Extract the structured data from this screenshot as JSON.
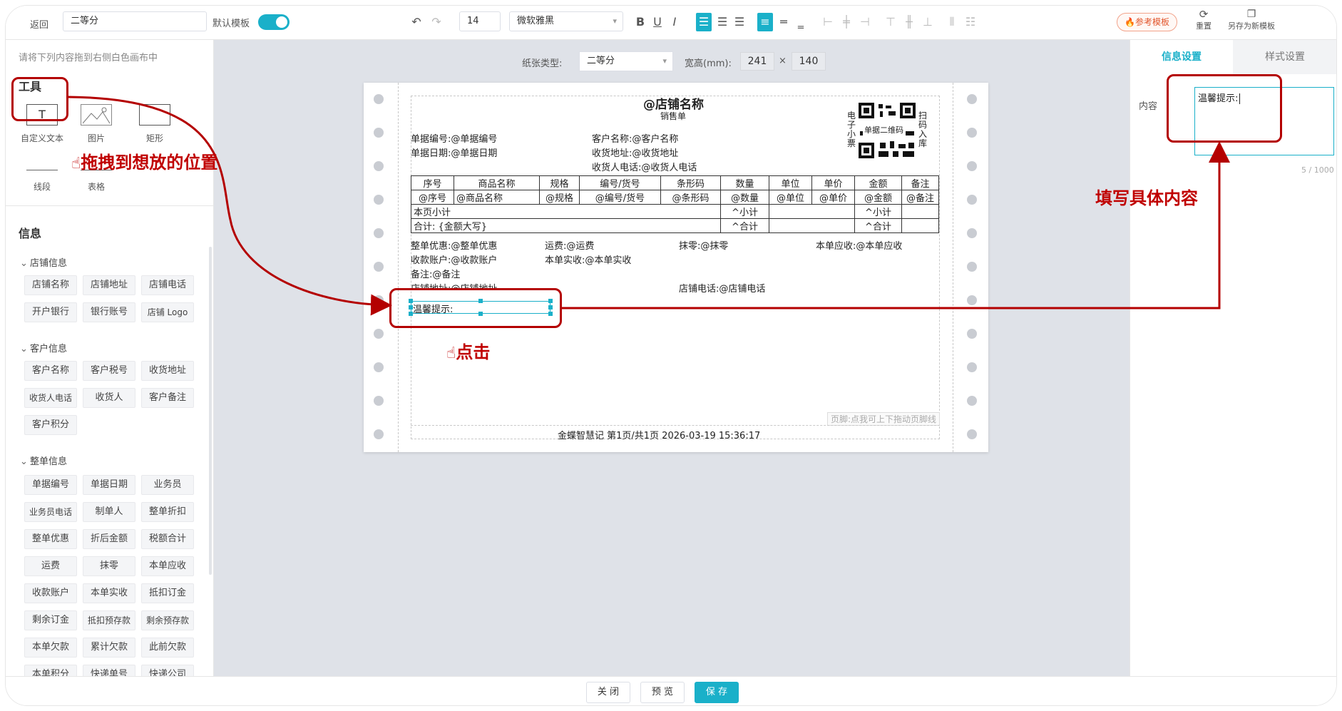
{
  "toolbar": {
    "back_label": "返回",
    "template_name": "二等分",
    "default_template_label": "默认模板",
    "font_size": "14",
    "font_family": "微软雅黑",
    "bold": "B",
    "underline": "U",
    "italic": "I",
    "ref_template": "参考模板",
    "reset": "重置",
    "save_as_new": "另存为新模板"
  },
  "left": {
    "hint": "请将下列内容拖到右侧白色画布中",
    "tools_title": "工具",
    "tools": [
      {
        "label": "自定义文本",
        "glyph": "T"
      },
      {
        "label": "图片"
      },
      {
        "label": "矩形"
      },
      {
        "label": "线段"
      },
      {
        "label": "表格"
      }
    ],
    "info_title": "信息",
    "groups": [
      {
        "title": "店铺信息",
        "items": [
          "店铺名称",
          "店铺地址",
          "店铺电话",
          "开户银行",
          "银行账号",
          "店铺 Logo"
        ]
      },
      {
        "title": "客户信息",
        "items": [
          "客户名称",
          "客户税号",
          "收货地址",
          "收货人电话",
          "收货人",
          "客户备注",
          "客户积分"
        ]
      },
      {
        "title": "整单信息",
        "items": [
          "单据编号",
          "单据日期",
          "业务员",
          "业务员电话",
          "制单人",
          "整单折扣",
          "整单优惠",
          "折后金额",
          "税额合计",
          "运费",
          "抹零",
          "本单应收",
          "收款账户",
          "本单实收",
          "抵扣订金",
          "剩余订金",
          "抵扣预存款",
          "剩余预存款",
          "本单欠款",
          "累计欠款",
          "此前欠款",
          "本单积分",
          "快递单号",
          "快递公司"
        ]
      }
    ]
  },
  "canvas": {
    "paper_type_label": "纸张类型:",
    "paper_type": "二等分",
    "size_label": "宽高(mm):",
    "width": "241",
    "times": "×",
    "height": "140",
    "shop_name": "@店铺名称",
    "doc_type": "销售单",
    "qr_left": "电子小票",
    "qr_center": "单据二维码",
    "qr_right": "扫码入库",
    "fields": {
      "doc_no": "单据编号:@单据编号",
      "doc_date": "单据日期:@单据日期",
      "customer": "客户名称:@客户名称",
      "address": "收货地址:@收货地址",
      "phone": "收货人电话:@收货人电话",
      "discount": "整单优惠:@整单优惠",
      "freight": "运费:@运费",
      "rounding": "抹零:@抹零",
      "receivable": "本单应收:@本单应收",
      "account": "收款账户:@收款账户",
      "received": "本单实收:@本单实收",
      "remark": "备注:@备注",
      "shop_address": "店铺地址:@店铺地址",
      "shop_phone": "店铺电话:@店铺电话",
      "tip": "温馨提示:"
    },
    "table": {
      "headers": [
        "序号",
        "商品名称",
        "规格",
        "编号/货号",
        "条形码",
        "数量",
        "单位",
        "单价",
        "金额",
        "备注"
      ],
      "row": [
        "@序号",
        "@商品名称",
        "@规格",
        "@编号/货号",
        "@条形码",
        "@数量",
        "@单位",
        "@单价",
        "@金额",
        "@备注"
      ],
      "page_subtotal": "本页小计",
      "subtotal_qty": "^小计",
      "subtotal_amt": "^小计",
      "total": "合计: {金额大写}",
      "total_qty": "^合计",
      "total_amt": "^合计"
    },
    "footer_hint": "页脚:点我可上下拖动页脚线",
    "footer": "金蝶智慧记   第1页/共1页   2026-03-19 15:36:17"
  },
  "right": {
    "tab_info": "信息设置",
    "tab_style": "样式设置",
    "content_label": "内容",
    "content_value": "温馨提示:",
    "counter": "5 / 1000"
  },
  "bottom": {
    "close": "关 闭",
    "preview": "预 览",
    "save": "保 存"
  },
  "annotations": {
    "drag": "拖拽到想放的位置",
    "click": "点击",
    "fill": "填写具体内容",
    "color": "#c00000"
  }
}
